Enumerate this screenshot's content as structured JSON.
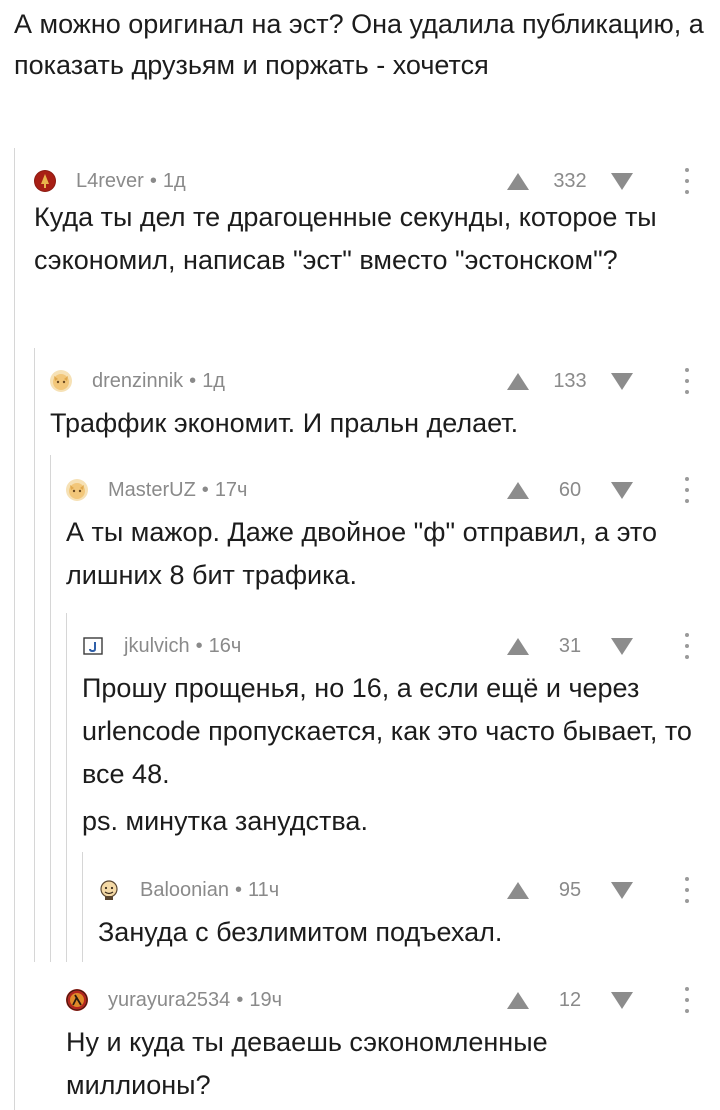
{
  "root": {
    "text": "А можно оригинал на эст? Она удалила публикацию, а показать друзьям и поржать - хочется"
  },
  "comments": [
    {
      "author": "L4rever",
      "time": "1д",
      "score": "332",
      "text": "Куда ты дел те драгоценные секунды, которое ты сэкономил, написав \"эст\" вместо \"эстонском\"?",
      "avatar_icon": "red-emblem-avatar-icon",
      "avatar_color": "#b3261e"
    },
    {
      "author": "drenzinnik",
      "time": "1д",
      "score": "133",
      "text": "Траффик экономит. И пральн делает.",
      "avatar_icon": "cat-avatar-icon",
      "avatar_color": "#f0c987"
    },
    {
      "author": "MasterUZ",
      "time": "17ч",
      "score": "60",
      "text": "А ты мажор. Даже двойное \"ф\" отправил, а это лишних 8 бит трафика.",
      "avatar_icon": "cat-avatar-icon",
      "avatar_color": "#f0c987"
    },
    {
      "author": "jkulvich",
      "time": "16ч",
      "score": "31",
      "text": "Прошу прощенья, но 16, а если ещё и через urlencode пропускается, как это часто бывает, то все 48.",
      "text2": "ps. минутка занудства.",
      "avatar_icon": "letter-j-avatar-icon",
      "avatar_color": "#3a6fb0"
    },
    {
      "author": "Baloonian",
      "time": "11ч",
      "score": "95",
      "text": "Зануда с безлимитом подъехал.",
      "avatar_icon": "cartoon-face-avatar-icon",
      "avatar_color": "#f2d6a2"
    },
    {
      "author": "yurayura2534",
      "time": "19ч",
      "score": "12",
      "text": "Ну и куда ты деваешь сэкономленные миллионы?",
      "avatar_icon": "lambda-avatar-icon",
      "avatar_color": "#b3261e"
    }
  ],
  "separator": "•"
}
